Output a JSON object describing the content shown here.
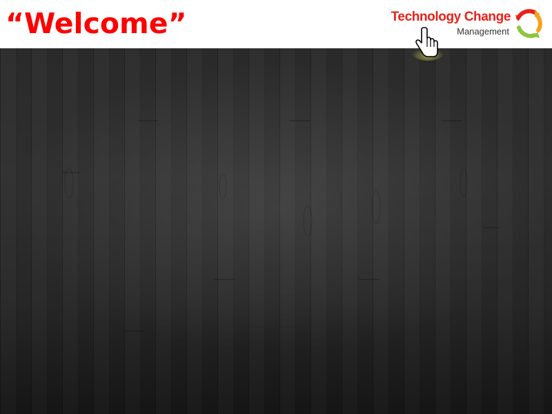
{
  "slide": {
    "title": "“Welcome”"
  },
  "logo": {
    "line1": "Technology Change",
    "line2": "Management",
    "colors": [
      "#e8221a",
      "#f7a21b",
      "#8cc63f"
    ]
  },
  "theme": {
    "title_color": "#ff0000",
    "header_background": "#ffffff",
    "background": "dark-wood"
  },
  "cursor": {
    "icon": "hand-pointer-icon"
  }
}
